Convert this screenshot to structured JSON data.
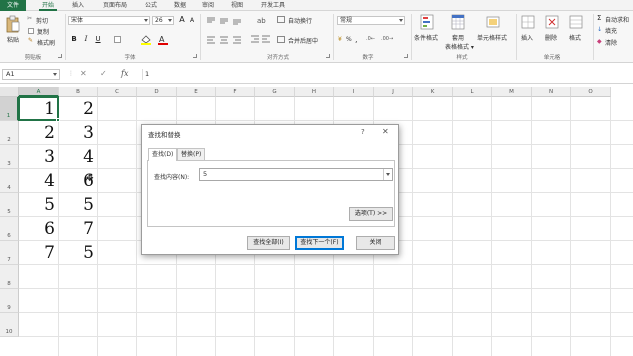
{
  "tabs": [
    "文件",
    "开始",
    "插入",
    "页面布局",
    "公式",
    "数据",
    "审阅",
    "视图",
    "开发工具"
  ],
  "ribbon": {
    "clipboard": {
      "cut": "剪切",
      "copy": "复制",
      "paste": "粘贴",
      "format_painter": "格式刷",
      "label": "剪贴板"
    },
    "font": {
      "name": "宋体",
      "size": "26",
      "bold": "B",
      "italic": "I",
      "underline": "U",
      "grow": "A",
      "shrink": "A",
      "label": "字体"
    },
    "alignment": {
      "wrap": "自动换行",
      "merge": "合并后居中",
      "label": "对齐方式"
    },
    "number": {
      "format": "常规",
      "percent": "%",
      "comma": ",",
      "label": "数字"
    },
    "styles": {
      "conditional": "条件格式",
      "table": "套用\n表格格式",
      "cell": "单元格样式",
      "label": "样式"
    },
    "cells": {
      "insert": "插入",
      "delete": "删除",
      "format": "格式",
      "label": "单元格"
    },
    "editing": {
      "autosum": "自动求和",
      "fill": "填充",
      "clear": "清除"
    }
  },
  "formula_bar": {
    "name_box": "A1",
    "cancel": "✕",
    "enter": "✓",
    "fx": "fx",
    "value": "1"
  },
  "columns": [
    "A",
    "B",
    "C",
    "D",
    "E",
    "F",
    "G",
    "H",
    "I",
    "J",
    "K",
    "L",
    "M",
    "N",
    "O"
  ],
  "rows": [
    "1",
    "2",
    "3",
    "4",
    "5",
    "6",
    "7",
    "8",
    "9",
    "10"
  ],
  "cells": {
    "A": [
      "1",
      "2",
      "3",
      "4",
      "5",
      "6",
      "7"
    ],
    "B": [
      "2",
      "3",
      "4",
      "6",
      "5",
      "7",
      "5"
    ]
  },
  "dialog": {
    "title": "查找和替换",
    "help": "?",
    "close": "✕",
    "tab_find": "查找(D)",
    "tab_replace": "替换(P)",
    "find_label": "查找内容(N):",
    "find_value": "5",
    "options_button": "选项(T) >>",
    "find_all_button": "查找全部(I)",
    "find_next_button": "查找下一个(F)",
    "close_button": "关闭"
  }
}
